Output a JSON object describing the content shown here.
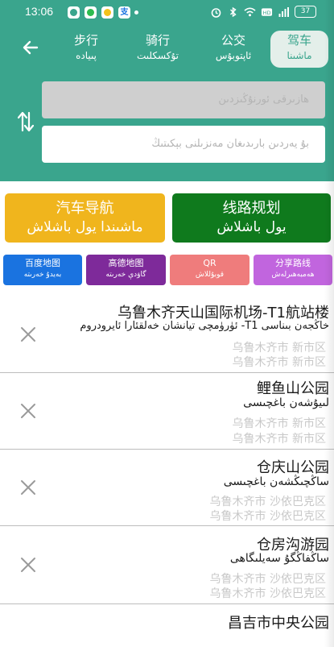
{
  "status": {
    "time": "13:06",
    "battery": "37"
  },
  "tabs": [
    {
      "cn": "步行",
      "ug": "پىيادە"
    },
    {
      "cn": "骑行",
      "ug": "تۇكسكلىت"
    },
    {
      "cn": "公交",
      "ug": "ئاپتوبۇس"
    },
    {
      "cn": "驾车",
      "ug": "ماشىنا"
    }
  ],
  "inputs": {
    "from_placeholder": "ھازىرقى ئورنۇڭىزدىن",
    "to_placeholder": "بۇ يەردىن بارىدىغان مەنزىلنى بېكىتىڭ"
  },
  "buttons": {
    "navigation": {
      "cn": "汽车导航",
      "ug": "ماشىندا يول باشلاش"
    },
    "route_plan": {
      "cn": "线路规划",
      "ug": "يول باشلاش"
    },
    "baidu": {
      "cn": "百度地图",
      "ug": "بەيدۇ خەرىتە"
    },
    "gaode": {
      "cn": "高德地图",
      "ug": "گاۋدې خەرىتە"
    },
    "qr": {
      "cn": "QR",
      "ug": "قوبۇللاش"
    },
    "share": {
      "cn": "分享路线",
      "ug": "ھەمبەھىرلەش"
    }
  },
  "colors": {
    "header": "#3aa58d",
    "navigation": "#f0b51d",
    "route_plan": "#0f7a1d",
    "baidu": "#1a73e0",
    "gaode": "#7e2a9a",
    "qr": "#ef7c7c",
    "share": "#c165de"
  },
  "history": [
    {
      "title_cn": "乌鲁木齐天山国际机场-T1航站楼",
      "title_ug": "ئۈرۈمچى تيانشان خەلقئارا ئايرودروم -T1 خاڭجەن بىناسى",
      "addr1": "乌鲁木齐市 新市区",
      "addr2": "乌鲁木齐市 新市区"
    },
    {
      "title_cn": "鲤鱼山公园",
      "title_ug": "لىيۇشەن باغچىسى",
      "addr1": "乌鲁木齐市 新市区",
      "addr2": "乌鲁木齐市 新市区"
    },
    {
      "title_cn": "仓庆山公园",
      "title_ug": "ساڭچىڭشەن باغچىسى",
      "addr1": "乌鲁木齐市 沙依巴克区",
      "addr2": "乌鲁木齐市 沙依巴克区"
    },
    {
      "title_cn": "仓房沟游园",
      "title_ug": "ساڭفاڭگۇ سەيلىگاھى",
      "addr1": "乌鲁木齐市 沙依巴克区",
      "addr2": "乌鲁木齐市 沙依巴克区"
    },
    {
      "title_cn": "昌吉市中央公园",
      "title_ug": "",
      "addr1": "",
      "addr2": ""
    }
  ]
}
